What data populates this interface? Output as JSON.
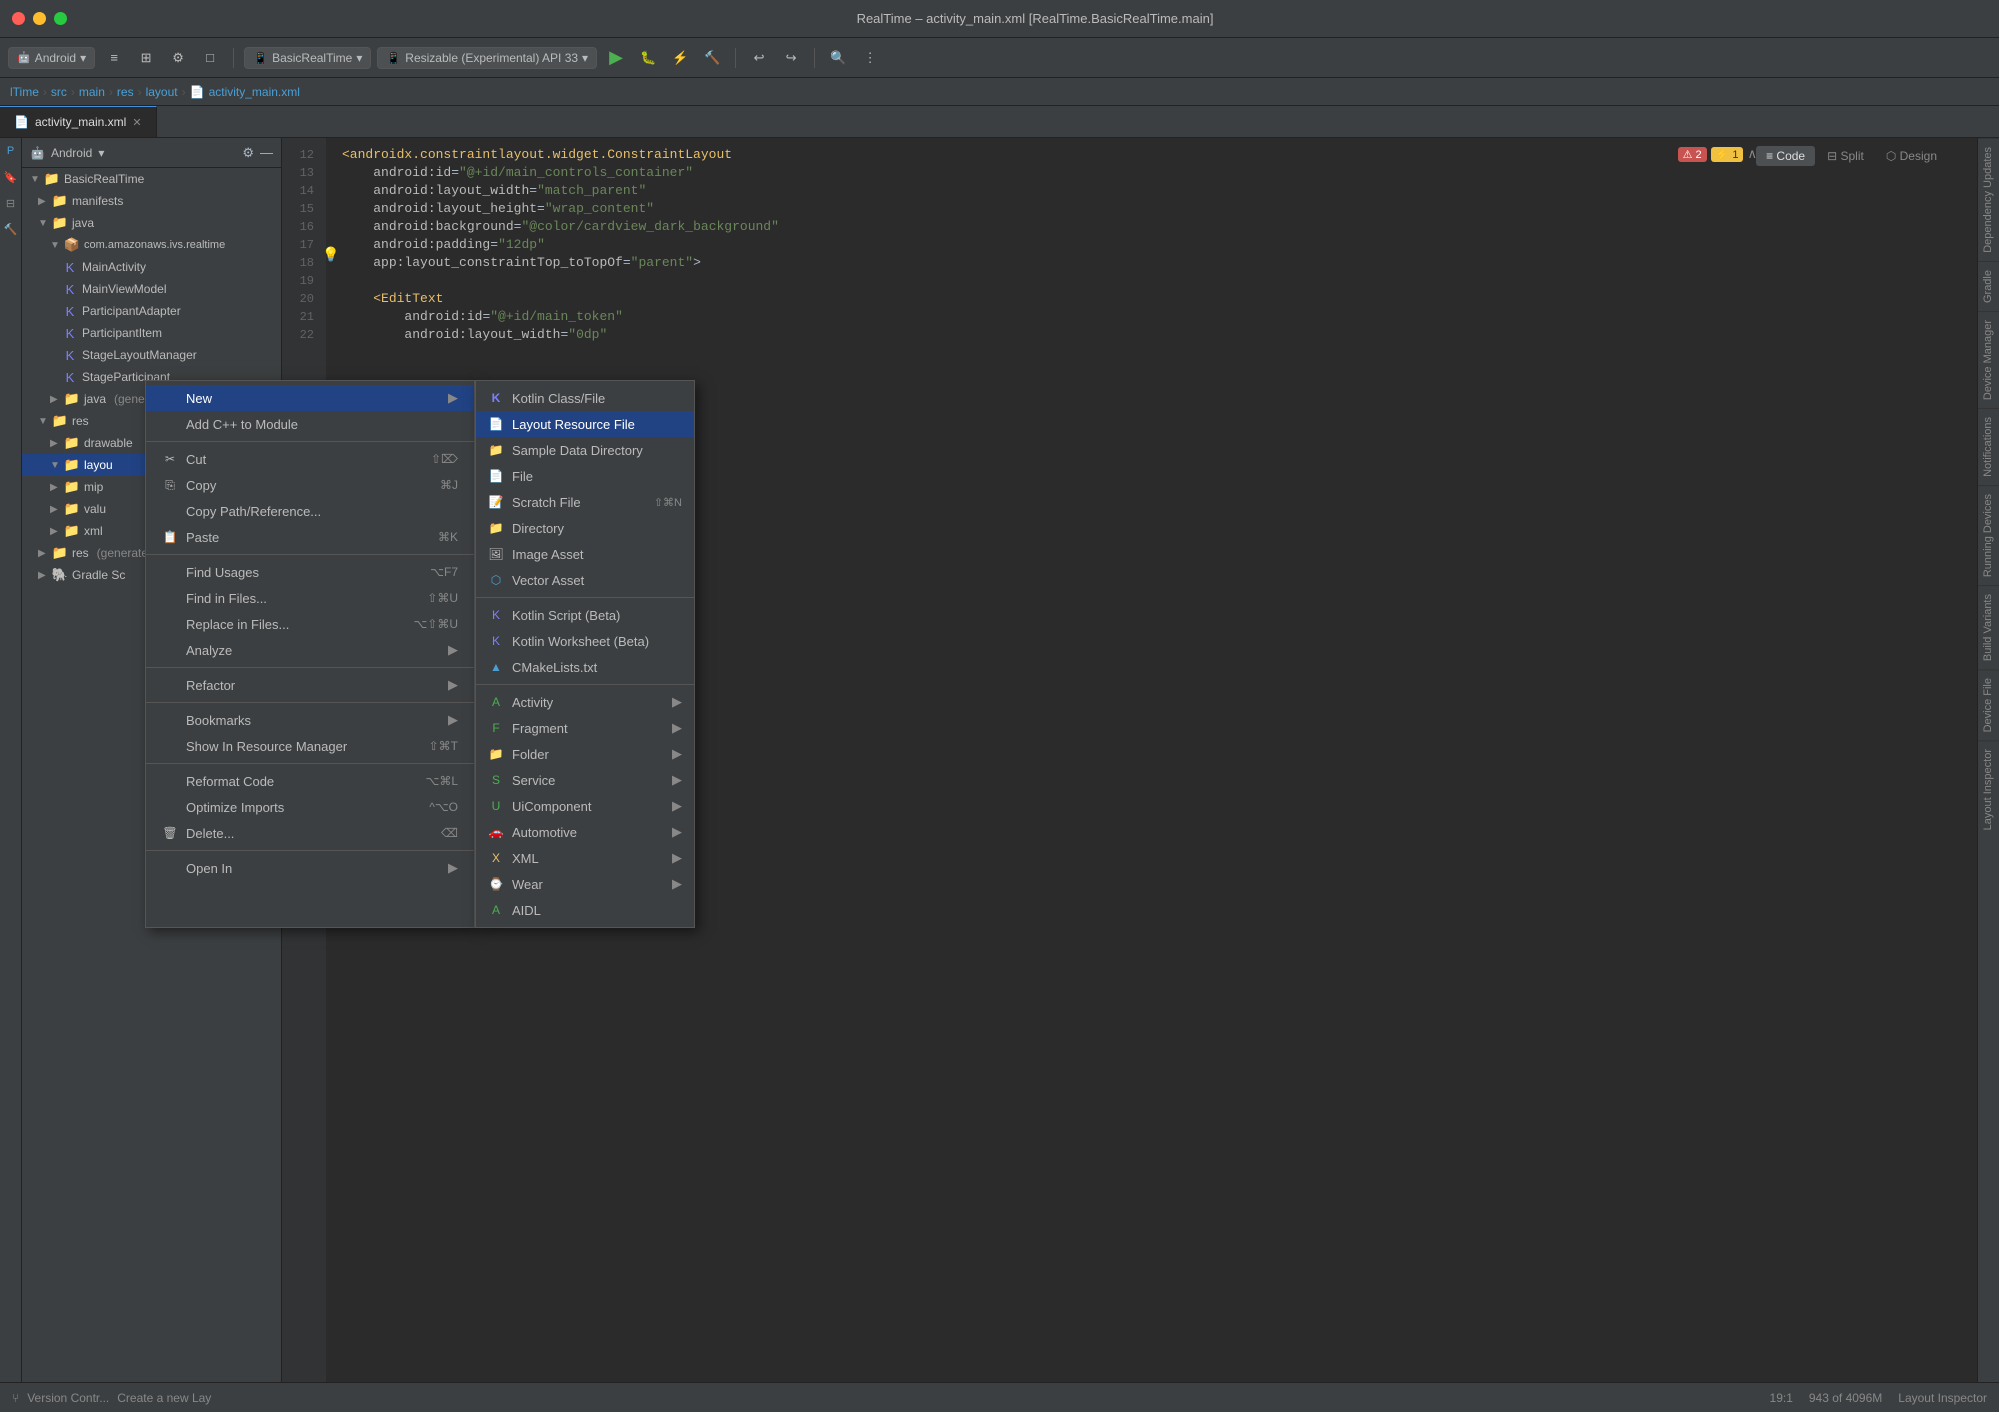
{
  "titleBar": {
    "title": "RealTime – activity_main.xml [RealTime.BasicRealTime.main]"
  },
  "toolbar": {
    "androidDropdown": "Android",
    "basicRealTimeDropdown": "BasicRealTime",
    "apiDropdown": "Resizable (Experimental) API 33",
    "runBtn": "▶",
    "buildBtn": "🔨",
    "profileBtn": "⚡"
  },
  "breadcrumb": {
    "items": [
      "lTime",
      "src",
      "main",
      "res",
      "layout",
      "activity_main.xml"
    ]
  },
  "tabs": [
    {
      "label": "activity_main.xml",
      "active": true
    }
  ],
  "sidebar": {
    "title": "Android",
    "rootLabel": "BasicRealTime",
    "items": [
      {
        "label": "manifests",
        "indent": 1,
        "type": "folder"
      },
      {
        "label": "java",
        "indent": 1,
        "type": "folder",
        "expanded": true
      },
      {
        "label": "com.amazonaws.ivs.realtime",
        "indent": 2,
        "type": "package"
      },
      {
        "label": "MainActivity",
        "indent": 3,
        "type": "class"
      },
      {
        "label": "MainViewModel",
        "indent": 3,
        "type": "class"
      },
      {
        "label": "ParticipantAdapter",
        "indent": 3,
        "type": "class"
      },
      {
        "label": "ParticipantItem",
        "indent": 3,
        "type": "class"
      },
      {
        "label": "StageLayoutManager",
        "indent": 3,
        "type": "class"
      },
      {
        "label": "StageParticipant",
        "indent": 3,
        "type": "class"
      },
      {
        "label": "java (generated)",
        "indent": 2,
        "type": "folder"
      },
      {
        "label": "res",
        "indent": 1,
        "type": "folder",
        "expanded": true
      },
      {
        "label": "drawable",
        "indent": 2,
        "type": "folder"
      },
      {
        "label": "layou",
        "indent": 2,
        "type": "folder",
        "selected": true
      },
      {
        "label": "mip",
        "indent": 2,
        "type": "folder"
      },
      {
        "label": "valu",
        "indent": 2,
        "type": "folder"
      },
      {
        "label": "xml",
        "indent": 2,
        "type": "folder"
      },
      {
        "label": "res (generated)",
        "indent": 1,
        "type": "folder"
      },
      {
        "label": "Gradle Scripts",
        "indent": 1,
        "type": "folder"
      }
    ]
  },
  "codeEditor": {
    "lines": [
      {
        "num": 12,
        "content": "<androidx.constraintlayout.widget.ConstraintLayout",
        "type": "tag"
      },
      {
        "num": 13,
        "content": "    android:id=\"@+id/main_controls_container\"",
        "type": "attr"
      },
      {
        "num": 14,
        "content": "    android:layout_width=\"match_parent\"",
        "type": "attr"
      },
      {
        "num": 15,
        "content": "    android:layout_height=\"wrap_content\"",
        "type": "attr"
      },
      {
        "num": 16,
        "content": "    android:background=\"@color/cardview_dark_background\"",
        "type": "attr"
      },
      {
        "num": 17,
        "content": "    android:padding=\"12dp\"",
        "type": "attr"
      },
      {
        "num": 18,
        "content": "    app:layout_constraintTop_toTopOf=\"parent\">",
        "type": "attr",
        "hasHint": true
      },
      {
        "num": 19,
        "content": "",
        "type": "empty"
      },
      {
        "num": 20,
        "content": "    <EditText",
        "type": "tag"
      },
      {
        "num": 21,
        "content": "        android:id=\"@+id/main_token\"",
        "type": "attr"
      },
      {
        "num": 22,
        "content": "        android:layout_width=\"0dp\"",
        "type": "attr"
      }
    ]
  },
  "contextMenu": {
    "items": [
      {
        "label": "New",
        "hasArrow": true,
        "highlighted": true
      },
      {
        "label": "Add C++ to Module",
        "hasArrow": false
      },
      {
        "separator": true
      },
      {
        "label": "Cut",
        "icon": "✂",
        "shortcut": "⇧⌦"
      },
      {
        "label": "Copy",
        "icon": "",
        "shortcut": "⌘J"
      },
      {
        "label": "Copy Path/Reference...",
        "icon": ""
      },
      {
        "label": "Paste",
        "icon": "",
        "shortcut": "⌘K"
      },
      {
        "separator": true
      },
      {
        "label": "Find Usages",
        "shortcut": "⌥F7"
      },
      {
        "label": "Find in Files...",
        "shortcut": "⇧⌘U"
      },
      {
        "label": "Replace in Files...",
        "shortcut": "⌥⇧⌘U"
      },
      {
        "label": "Analyze",
        "hasArrow": true
      },
      {
        "separator": true
      },
      {
        "label": "Refactor",
        "hasArrow": true
      },
      {
        "separator": true
      },
      {
        "label": "Bookmarks",
        "hasArrow": true
      },
      {
        "label": "Show In Resource Manager",
        "shortcut": "⇧⌘T"
      },
      {
        "separator": true
      },
      {
        "label": "Reformat Code",
        "shortcut": "⌥⌘L"
      },
      {
        "label": "Optimize Imports",
        "shortcut": "^⌥O"
      },
      {
        "label": "Delete...",
        "icon": "",
        "shortcut": "⌫"
      },
      {
        "separator": true
      },
      {
        "label": "Open In",
        "hasArrow": true
      }
    ]
  },
  "newSubmenu": {
    "items": [
      {
        "label": "Kotlin Class/File",
        "icon": "K",
        "iconColor": "#7c7fff"
      },
      {
        "label": "Layout Resource File",
        "icon": "📄",
        "highlighted": true
      },
      {
        "label": "Sample Data Directory",
        "icon": "📁"
      },
      {
        "label": "File",
        "icon": "📄"
      },
      {
        "label": "Scratch File",
        "icon": "📝",
        "shortcut": "⇧⌘N"
      },
      {
        "label": "Directory",
        "icon": "📁"
      },
      {
        "label": "Image Asset",
        "icon": "🖼"
      },
      {
        "label": "Vector Asset",
        "icon": "⬡"
      },
      {
        "separator": true
      },
      {
        "label": "Kotlin Script (Beta)",
        "icon": "K"
      },
      {
        "label": "Kotlin Worksheet (Beta)",
        "icon": "K"
      },
      {
        "label": "CMakeLists.txt",
        "icon": "⚙"
      },
      {
        "separator": true
      },
      {
        "label": "Activity",
        "icon": "A",
        "hasArrow": true
      },
      {
        "label": "Fragment",
        "icon": "F",
        "hasArrow": true
      },
      {
        "label": "Folder",
        "icon": "📁",
        "hasArrow": true
      },
      {
        "label": "Service",
        "icon": "S",
        "hasArrow": true
      },
      {
        "label": "UiComponent",
        "icon": "U",
        "hasArrow": true
      },
      {
        "label": "Automotive",
        "icon": "🚗",
        "hasArrow": true
      },
      {
        "label": "XML",
        "icon": "X",
        "hasArrow": true
      },
      {
        "label": "Wear",
        "icon": "⌚",
        "hasArrow": true
      },
      {
        "label": "AIDL",
        "icon": "A"
      }
    ]
  },
  "statusBar": {
    "vcsLabel": "Version Contr...",
    "createLayerLabel": "Create a new Lay",
    "errorCount": "2",
    "warningCount": "1",
    "position": "19:1",
    "memInfo": "943 of 4096M",
    "codeViewTabs": [
      "Code",
      "Split",
      "Design"
    ]
  }
}
